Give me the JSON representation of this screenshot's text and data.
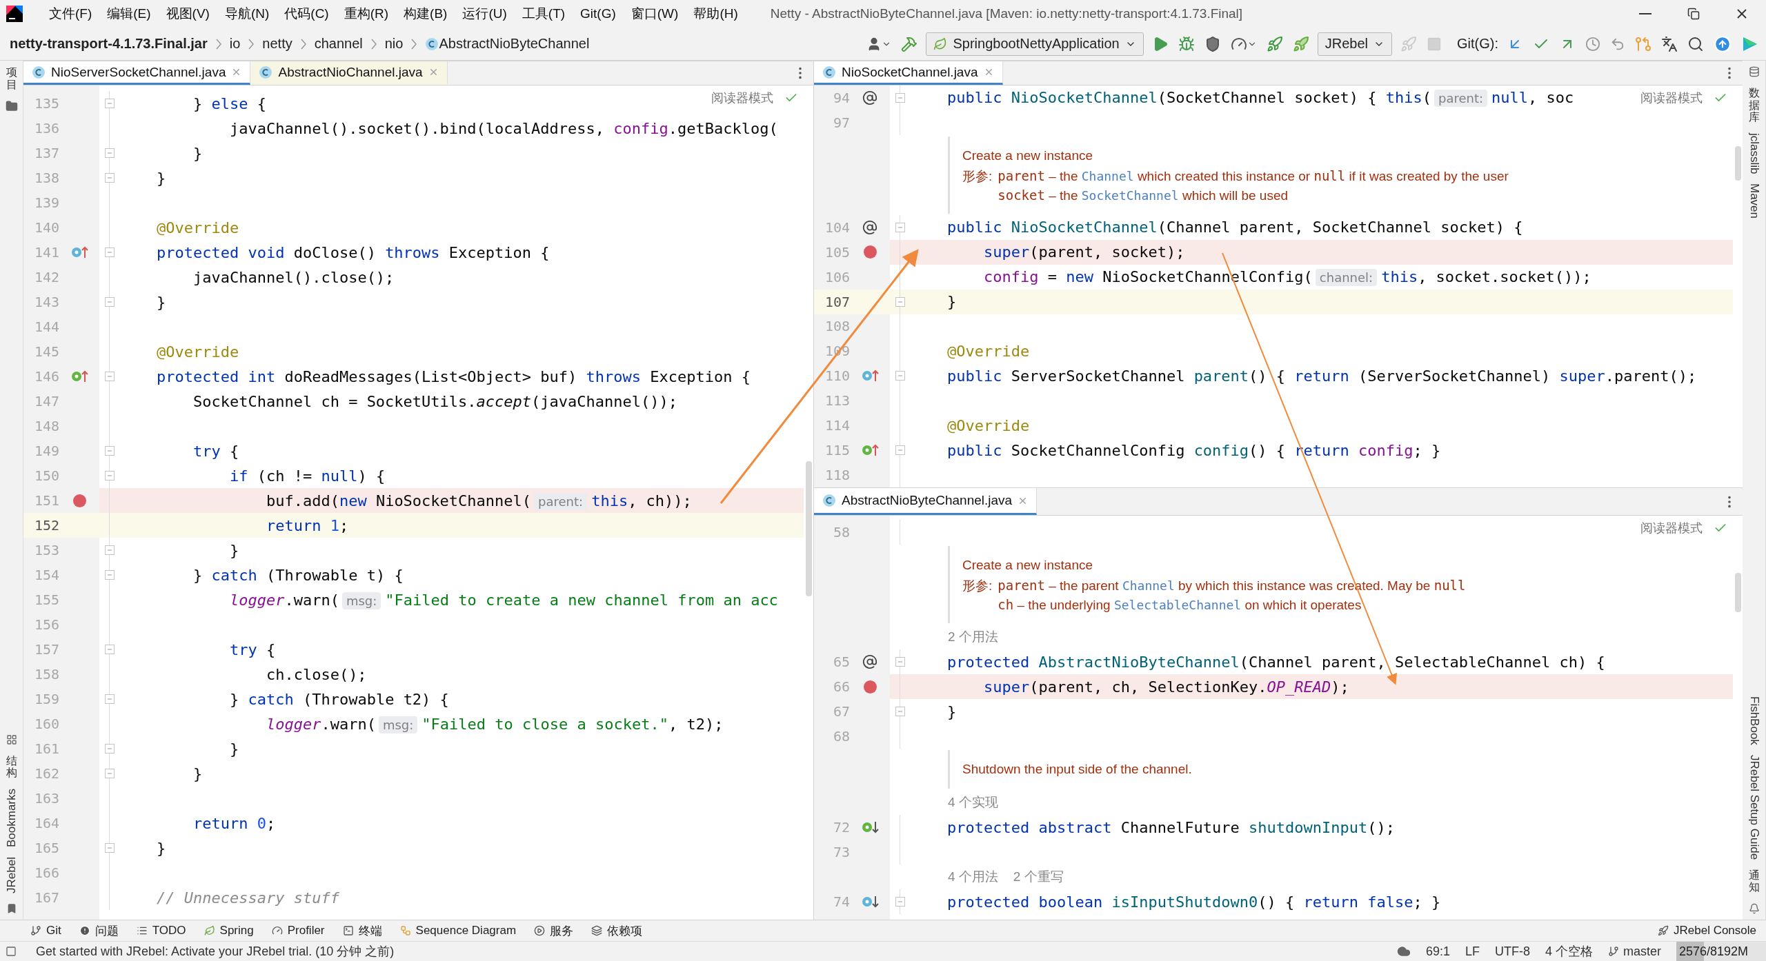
{
  "menu_bar": {
    "items": [
      "文件(F)",
      "编辑(E)",
      "视图(V)",
      "导航(N)",
      "代码(C)",
      "重构(R)",
      "构建(B)",
      "运行(U)",
      "工具(T)",
      "Git(G)",
      "窗口(W)",
      "帮助(H)"
    ],
    "title": "Netty - AbstractNioByteChannel.java [Maven: io.netty:netty-transport:4.1.73.Final]"
  },
  "nav_bar": {
    "breadcrumbs": [
      {
        "label": "netty-transport-4.1.73.Final.jar",
        "kind": "jar"
      },
      {
        "label": "io",
        "kind": "package"
      },
      {
        "label": "netty",
        "kind": "package"
      },
      {
        "label": "channel",
        "kind": "package"
      },
      {
        "label": "nio",
        "kind": "package"
      },
      {
        "label": "AbstractNioByteChannel",
        "kind": "class"
      }
    ]
  },
  "toolbar": {
    "items": [
      {
        "kind": "user",
        "disabled": false
      },
      {
        "kind": "build",
        "disabled": false
      },
      {
        "kind": "run_config",
        "label": "SpringbootNettyApplication",
        "disabled": false
      },
      {
        "kind": "run",
        "disabled": false
      },
      {
        "kind": "debug",
        "disabled": false
      },
      {
        "kind": "coverage",
        "disabled": false
      },
      {
        "kind": "profile",
        "disabled": false
      },
      {
        "kind": "jrebel_run",
        "disabled": false
      },
      {
        "kind": "jrebel_debug",
        "disabled": false
      },
      {
        "kind": "dropdown",
        "label": "JRebel",
        "disabled": false
      },
      {
        "kind": "rocket",
        "disabled": true
      },
      {
        "kind": "stop",
        "disabled": true
      },
      {
        "kind": "label",
        "label": "Git(G):"
      },
      {
        "kind": "update",
        "disabled": false
      },
      {
        "kind": "commit",
        "disabled": false
      },
      {
        "kind": "push",
        "disabled": false
      },
      {
        "kind": "history",
        "disabled": false
      },
      {
        "kind": "rollback",
        "disabled": false
      },
      {
        "kind": "vcs",
        "disabled": false
      },
      {
        "kind": "translate",
        "disabled": false
      },
      {
        "kind": "search",
        "disabled": false
      },
      {
        "kind": "upgrade",
        "disabled": false
      },
      {
        "kind": "toolbox",
        "disabled": false
      }
    ]
  },
  "left_stripe": {
    "top": [
      {
        "label": "项目",
        "kind": "cjk"
      }
    ],
    "bottom": [
      {
        "label": "结构",
        "kind": "cjk"
      },
      {
        "label": "Bookmarks",
        "kind": "latin"
      },
      {
        "label": "JRebel",
        "kind": "latin"
      }
    ]
  },
  "left_editor": {
    "reader_mode": "阅读器模式",
    "tabs": [
      {
        "label": "NioServerSocketChannel.java",
        "selected": true
      },
      {
        "label": "AbstractNioChannel.java",
        "selected": false
      }
    ],
    "lines": [
      {
        "kind": "code",
        "num": "135",
        "fold": true,
        "breakpoint": false,
        "current": false,
        "code": [
          {
            "kind": "plain",
            "text": "        } "
          },
          {
            "kind": "keyword",
            "text": "else"
          },
          {
            "kind": "plain",
            "text": " {"
          }
        ]
      },
      {
        "kind": "code",
        "num": "136",
        "fold": false,
        "breakpoint": false,
        "current": false,
        "code": [
          {
            "kind": "plain",
            "text": "            javaChannel().socket().bind(localAddress, "
          },
          {
            "kind": "field",
            "text": "config"
          },
          {
            "kind": "plain",
            "text": ".getBacklog("
          }
        ]
      },
      {
        "kind": "code",
        "num": "137",
        "fold": true,
        "breakpoint": false,
        "current": false,
        "code": [
          {
            "kind": "plain",
            "text": "        }"
          }
        ]
      },
      {
        "kind": "code",
        "num": "138",
        "fold": true,
        "breakpoint": false,
        "current": false,
        "code": [
          {
            "kind": "plain",
            "text": "    }"
          }
        ]
      },
      {
        "kind": "code",
        "num": "139",
        "fold": false,
        "breakpoint": false,
        "current": false
      },
      {
        "kind": "code",
        "num": "140",
        "fold": false,
        "breakpoint": false,
        "current": false,
        "code": [
          {
            "kind": "annotation",
            "text": "    @Override"
          }
        ]
      },
      {
        "kind": "code",
        "num": "141",
        "fold": true,
        "breakpoint": false,
        "current": false,
        "marker": {
          "kind": "override_up"
        },
        "code": [
          {
            "kind": "keyword",
            "text": "    protected void"
          },
          {
            "kind": "plain",
            "text": " doClose() "
          },
          {
            "kind": "keyword",
            "text": "throws"
          },
          {
            "kind": "plain",
            "text": " Exception {"
          }
        ]
      },
      {
        "kind": "code",
        "num": "142",
        "fold": false,
        "breakpoint": false,
        "current": false,
        "code": [
          {
            "kind": "plain",
            "text": "        javaChannel().close();"
          }
        ]
      },
      {
        "kind": "code",
        "num": "143",
        "fold": true,
        "breakpoint": false,
        "current": false,
        "code": [
          {
            "kind": "plain",
            "text": "    }"
          }
        ]
      },
      {
        "kind": "code",
        "num": "144",
        "fold": false,
        "breakpoint": false,
        "current": false
      },
      {
        "kind": "code",
        "num": "145",
        "fold": false,
        "breakpoint": false,
        "current": false,
        "code": [
          {
            "kind": "annotation",
            "text": "    @Override"
          }
        ]
      },
      {
        "kind": "code",
        "num": "146",
        "fold": true,
        "breakpoint": false,
        "current": false,
        "marker": {
          "kind": "implements_up"
        },
        "code": [
          {
            "kind": "keyword",
            "text": "    protected int"
          },
          {
            "kind": "plain",
            "text": " doReadMessages(List<Object> buf) "
          },
          {
            "kind": "keyword",
            "text": "throws"
          },
          {
            "kind": "plain",
            "text": " Exception {"
          }
        ]
      },
      {
        "kind": "code",
        "num": "147",
        "fold": false,
        "breakpoint": false,
        "current": false,
        "code": [
          {
            "kind": "plain",
            "text": "        SocketChannel ch = SocketUtils."
          },
          {
            "kind": "italic",
            "text": "accept"
          },
          {
            "kind": "plain",
            "text": "(javaChannel());"
          }
        ]
      },
      {
        "kind": "code",
        "num": "148",
        "fold": false,
        "breakpoint": false,
        "current": false
      },
      {
        "kind": "code",
        "num": "149",
        "fold": true,
        "breakpoint": false,
        "current": false,
        "code": [
          {
            "kind": "keyword",
            "text": "        try"
          },
          {
            "kind": "plain",
            "text": " {"
          }
        ]
      },
      {
        "kind": "code",
        "num": "150",
        "fold": true,
        "breakpoint": false,
        "current": false,
        "code": [
          {
            "kind": "keyword",
            "text": "            if"
          },
          {
            "kind": "plain",
            "text": " (ch != "
          },
          {
            "kind": "keyword",
            "text": "null"
          },
          {
            "kind": "plain",
            "text": ") {"
          }
        ]
      },
      {
        "kind": "code",
        "num": "151",
        "fold": false,
        "breakpoint": true,
        "current": false,
        "code": [
          {
            "kind": "plain",
            "text": "                buf.add("
          },
          {
            "kind": "keyword",
            "text": "new"
          },
          {
            "kind": "plain",
            "text": " NioSocketChannel("
          },
          {
            "kind": "hint",
            "text": "parent:"
          },
          {
            "kind": "keyword",
            "text": "this"
          },
          {
            "kind": "plain",
            "text": ", ch));"
          }
        ]
      },
      {
        "kind": "code",
        "num": "152",
        "fold": false,
        "breakpoint": false,
        "current": true,
        "code": [
          {
            "kind": "keyword",
            "text": "                return "
          },
          {
            "kind": "number",
            "text": "1"
          },
          {
            "kind": "plain",
            "text": ";"
          }
        ]
      },
      {
        "kind": "code",
        "num": "153",
        "fold": true,
        "breakpoint": false,
        "current": false,
        "code": [
          {
            "kind": "plain",
            "text": "            }"
          }
        ]
      },
      {
        "kind": "code",
        "num": "154",
        "fold": true,
        "breakpoint": false,
        "current": false,
        "code": [
          {
            "kind": "plain",
            "text": "        } "
          },
          {
            "kind": "keyword",
            "text": "catch"
          },
          {
            "kind": "plain",
            "text": " (Throwable t) {"
          }
        ]
      },
      {
        "kind": "code",
        "num": "155",
        "fold": false,
        "breakpoint": false,
        "current": false,
        "code": [
          {
            "kind": "static",
            "text": "            logger"
          },
          {
            "kind": "plain",
            "text": ".warn("
          },
          {
            "kind": "hint",
            "text": "msg:"
          },
          {
            "kind": "string",
            "text": "\"Failed to create a new channel from an acc"
          }
        ]
      },
      {
        "kind": "code",
        "num": "156",
        "fold": false,
        "breakpoint": false,
        "current": false
      },
      {
        "kind": "code",
        "num": "157",
        "fold": true,
        "breakpoint": false,
        "current": false,
        "code": [
          {
            "kind": "keyword",
            "text": "            try"
          },
          {
            "kind": "plain",
            "text": " {"
          }
        ]
      },
      {
        "kind": "code",
        "num": "158",
        "fold": false,
        "breakpoint": false,
        "current": false,
        "code": [
          {
            "kind": "plain",
            "text": "                ch.close();"
          }
        ]
      },
      {
        "kind": "code",
        "num": "159",
        "fold": true,
        "breakpoint": false,
        "current": false,
        "code": [
          {
            "kind": "plain",
            "text": "            } "
          },
          {
            "kind": "keyword",
            "text": "catch"
          },
          {
            "kind": "plain",
            "text": " (Throwable t2) {"
          }
        ]
      },
      {
        "kind": "code",
        "num": "160",
        "fold": false,
        "breakpoint": false,
        "current": false,
        "code": [
          {
            "kind": "static",
            "text": "                logger"
          },
          {
            "kind": "plain",
            "text": ".warn("
          },
          {
            "kind": "hint",
            "text": "msg:"
          },
          {
            "kind": "string",
            "text": "\"Failed to close a socket.\""
          },
          {
            "kind": "plain",
            "text": ", t2);"
          }
        ]
      },
      {
        "kind": "code",
        "num": "161",
        "fold": true,
        "breakpoint": false,
        "current": false,
        "code": [
          {
            "kind": "plain",
            "text": "            }"
          }
        ]
      },
      {
        "kind": "code",
        "num": "162",
        "fold": true,
        "breakpoint": false,
        "current": false,
        "code": [
          {
            "kind": "plain",
            "text": "        }"
          }
        ]
      },
      {
        "kind": "code",
        "num": "163",
        "fold": false,
        "breakpoint": false,
        "current": false
      },
      {
        "kind": "code",
        "num": "164",
        "fold": false,
        "breakpoint": false,
        "current": false,
        "code": [
          {
            "kind": "keyword",
            "text": "        return "
          },
          {
            "kind": "number",
            "text": "0"
          },
          {
            "kind": "plain",
            "text": ";"
          }
        ]
      },
      {
        "kind": "code",
        "num": "165",
        "fold": true,
        "breakpoint": false,
        "current": false,
        "code": [
          {
            "kind": "plain",
            "text": "    }"
          }
        ]
      },
      {
        "kind": "code",
        "num": "166",
        "fold": false,
        "breakpoint": false,
        "current": false
      },
      {
        "kind": "code",
        "num": "167",
        "fold": false,
        "breakpoint": false,
        "current": false,
        "code": [
          {
            "kind": "comment",
            "text": "    // Unnecessary stuff"
          }
        ]
      }
    ]
  },
  "right_top_editor": {
    "reader_mode": "阅读器模式",
    "tabs": [
      {
        "label": "NioSocketChannel.java",
        "selected": true
      }
    ],
    "lines": [
      {
        "kind": "code",
        "num": "94",
        "fold": true,
        "breakpoint": false,
        "current": false,
        "marker": {
          "kind": "at"
        },
        "code": [
          {
            "kind": "keyword",
            "text": "    public"
          },
          {
            "kind": "method",
            "text": " NioSocketChannel"
          },
          {
            "kind": "plain",
            "text": "(SocketChannel socket) { "
          },
          {
            "kind": "keyword",
            "text": "this"
          },
          {
            "kind": "plain",
            "text": "("
          },
          {
            "kind": "hint",
            "text": "parent:"
          },
          {
            "kind": "keyword",
            "text": "null"
          },
          {
            "kind": "plain",
            "text": ", soc"
          }
        ]
      },
      {
        "kind": "code",
        "num": "97",
        "fold": false,
        "breakpoint": false,
        "current": false
      },
      {
        "kind": "doc",
        "title": "Create a new instance",
        "params": [
          {
            "label": "形参:",
            "parts": [
              {
                "kind": "param",
                "text": "parent"
              },
              {
                "kind": "plain",
                "text": " – the "
              },
              {
                "kind": "link",
                "text": "Channel"
              },
              {
                "kind": "plain",
                "text": " which created this instance or "
              },
              {
                "kind": "param",
                "text": "null"
              },
              {
                "kind": "plain",
                "text": " if it was created by the user"
              }
            ]
          },
          {
            "parts": [
              {
                "kind": "param",
                "text": "socket"
              },
              {
                "kind": "plain",
                "text": " – the "
              },
              {
                "kind": "link",
                "text": "SocketChannel"
              },
              {
                "kind": "plain",
                "text": " which will be used"
              }
            ]
          }
        ]
      },
      {
        "kind": "code",
        "num": "104",
        "fold": true,
        "breakpoint": false,
        "current": false,
        "marker": {
          "kind": "at"
        },
        "code": [
          {
            "kind": "keyword",
            "text": "    public"
          },
          {
            "kind": "method",
            "text": " NioSocketChannel"
          },
          {
            "kind": "plain",
            "text": "(Channel parent, SocketChannel socket) {"
          }
        ]
      },
      {
        "kind": "code",
        "num": "105",
        "fold": false,
        "breakpoint": true,
        "current": false,
        "code": [
          {
            "kind": "keyword",
            "text": "        super"
          },
          {
            "kind": "plain",
            "text": "(parent, socket);"
          }
        ]
      },
      {
        "kind": "code",
        "num": "106",
        "fold": false,
        "breakpoint": false,
        "current": false,
        "code": [
          {
            "kind": "field",
            "text": "        config"
          },
          {
            "kind": "plain",
            "text": " = "
          },
          {
            "kind": "keyword",
            "text": "new"
          },
          {
            "kind": "plain",
            "text": " NioSocketChannelConfig("
          },
          {
            "kind": "hint",
            "text": "channel:"
          },
          {
            "kind": "keyword",
            "text": "this"
          },
          {
            "kind": "plain",
            "text": ", socket.socket());"
          }
        ]
      },
      {
        "kind": "code",
        "num": "107",
        "fold": true,
        "breakpoint": false,
        "current": true,
        "code": [
          {
            "kind": "plain",
            "text": "    }"
          }
        ]
      },
      {
        "kind": "code",
        "num": "108",
        "fold": false,
        "breakpoint": false,
        "current": false
      },
      {
        "kind": "code",
        "num": "109",
        "fold": false,
        "breakpoint": false,
        "current": false,
        "code": [
          {
            "kind": "annotation",
            "text": "    @Override"
          }
        ]
      },
      {
        "kind": "code",
        "num": "110",
        "fold": true,
        "breakpoint": false,
        "current": false,
        "marker": {
          "kind": "override_up"
        },
        "code": [
          {
            "kind": "keyword",
            "text": "    public"
          },
          {
            "kind": "plain",
            "text": " ServerSocketChannel "
          },
          {
            "kind": "method",
            "text": "parent"
          },
          {
            "kind": "plain",
            "text": "() { "
          },
          {
            "kind": "keyword",
            "text": "return"
          },
          {
            "kind": "plain",
            "text": " (ServerSocketChannel) "
          },
          {
            "kind": "keyword",
            "text": "super"
          },
          {
            "kind": "plain",
            "text": ".parent();"
          }
        ]
      },
      {
        "kind": "code",
        "num": "113",
        "fold": false,
        "breakpoint": false,
        "current": false
      },
      {
        "kind": "code",
        "num": "114",
        "fold": false,
        "breakpoint": false,
        "current": false,
        "code": [
          {
            "kind": "annotation",
            "text": "    @Override"
          }
        ]
      },
      {
        "kind": "code",
        "num": "115",
        "fold": true,
        "breakpoint": false,
        "current": false,
        "marker": {
          "kind": "implements_up"
        },
        "code": [
          {
            "kind": "keyword",
            "text": "    public"
          },
          {
            "kind": "plain",
            "text": " SocketChannelConfig "
          },
          {
            "kind": "method",
            "text": "config"
          },
          {
            "kind": "plain",
            "text": "() { "
          },
          {
            "kind": "keyword",
            "text": "return "
          },
          {
            "kind": "field",
            "text": "config"
          },
          {
            "kind": "plain",
            "text": "; }"
          }
        ]
      },
      {
        "kind": "code",
        "num": "118",
        "fold": false,
        "breakpoint": false,
        "current": false
      }
    ]
  },
  "right_bottom_editor": {
    "reader_mode": "阅读器模式",
    "tabs": [
      {
        "label": "AbstractNioByteChannel.java",
        "selected": true
      }
    ],
    "lines": [
      {
        "kind": "code",
        "num": "58",
        "fold": false,
        "breakpoint": false,
        "current": false
      },
      {
        "kind": "doc",
        "title": "Create a new instance",
        "params": [
          {
            "label": "形参:",
            "parts": [
              {
                "kind": "param",
                "text": "parent"
              },
              {
                "kind": "plain",
                "text": " – the parent "
              },
              {
                "kind": "link",
                "text": "Channel"
              },
              {
                "kind": "plain",
                "text": " by which this instance was created. May be "
              },
              {
                "kind": "param",
                "text": "null"
              }
            ]
          },
          {
            "parts": [
              {
                "kind": "param",
                "text": "ch"
              },
              {
                "kind": "plain",
                "text": " – the underlying "
              },
              {
                "kind": "link",
                "text": "SelectableChannel"
              },
              {
                "kind": "plain",
                "text": " on which it operates"
              }
            ]
          }
        ]
      },
      {
        "kind": "usage",
        "texts": [
          "2 个用法"
        ]
      },
      {
        "kind": "code",
        "num": "65",
        "fold": true,
        "breakpoint": false,
        "current": false,
        "marker": {
          "kind": "at"
        },
        "code": [
          {
            "kind": "keyword",
            "text": "    protected"
          },
          {
            "kind": "method",
            "text": " AbstractNioByteChannel"
          },
          {
            "kind": "plain",
            "text": "(Channel parent, SelectableChannel ch) {"
          }
        ]
      },
      {
        "kind": "code",
        "num": "66",
        "fold": false,
        "breakpoint": true,
        "current": false,
        "code": [
          {
            "kind": "keyword",
            "text": "        super"
          },
          {
            "kind": "plain",
            "text": "(parent, ch, SelectionKey."
          },
          {
            "kind": "static",
            "text": "OP_READ"
          },
          {
            "kind": "plain",
            "text": ");"
          }
        ]
      },
      {
        "kind": "code",
        "num": "67",
        "fold": true,
        "breakpoint": false,
        "current": false,
        "code": [
          {
            "kind": "plain",
            "text": "    }"
          }
        ]
      },
      {
        "kind": "code",
        "num": "68",
        "fold": false,
        "breakpoint": false,
        "current": false
      },
      {
        "kind": "doc",
        "title": "Shutdown the input side of the channel."
      },
      {
        "kind": "usage",
        "texts": [
          "4 个实现"
        ]
      },
      {
        "kind": "code",
        "num": "72",
        "fold": false,
        "breakpoint": false,
        "current": false,
        "marker": {
          "kind": "implemented_down"
        },
        "code": [
          {
            "kind": "keyword",
            "text": "    protected abstract"
          },
          {
            "kind": "plain",
            "text": " ChannelFuture "
          },
          {
            "kind": "method",
            "text": "shutdownInput"
          },
          {
            "kind": "plain",
            "text": "();"
          }
        ]
      },
      {
        "kind": "code",
        "num": "73",
        "fold": false,
        "breakpoint": false,
        "current": false
      },
      {
        "kind": "usage",
        "texts": [
          "4 个用法",
          "2 个重写"
        ]
      },
      {
        "kind": "code",
        "num": "74",
        "fold": true,
        "breakpoint": false,
        "current": false,
        "marker": {
          "kind": "overridden_down"
        },
        "code": [
          {
            "kind": "keyword",
            "text": "    protected boolean"
          },
          {
            "kind": "method",
            "text": " isInputShutdown0"
          },
          {
            "kind": "plain",
            "text": "() { "
          },
          {
            "kind": "keyword",
            "text": "return false"
          },
          {
            "kind": "plain",
            "text": "; }"
          }
        ]
      }
    ]
  },
  "right_stripe": {
    "top": [
      {
        "label": "数据库",
        "kind": "cjk"
      },
      {
        "label": "jclasslib",
        "kind": "latin"
      },
      {
        "label": "Maven",
        "kind": "latin"
      }
    ],
    "bottom": [
      {
        "label": "FishBook",
        "kind": "latin"
      },
      {
        "label": "JRebel Setup Guide",
        "kind": "latin"
      },
      {
        "label": "通知",
        "kind": "cjk"
      }
    ]
  },
  "tool_windows": {
    "left": [
      {
        "label": "Git",
        "kind": "git"
      },
      {
        "label": "问题",
        "kind": "problems"
      },
      {
        "label": "TODO",
        "kind": "todo"
      },
      {
        "label": "Spring",
        "kind": "spring"
      },
      {
        "label": "Profiler",
        "kind": "profiler"
      },
      {
        "label": "终端",
        "kind": "terminal"
      },
      {
        "label": "Sequence Diagram",
        "kind": "sequence"
      },
      {
        "label": "服务",
        "kind": "services"
      },
      {
        "label": "依赖项",
        "kind": "dependencies"
      }
    ],
    "right": [
      {
        "label": "JRebel Console",
        "kind": "jrebel"
      }
    ]
  },
  "status_bar": {
    "message": "Get started with JRebel: Activate your JRebel trial. (10 分钟 之前)",
    "items": [
      {
        "label": "69:1",
        "kind": "position"
      },
      {
        "label": "LF",
        "kind": "text"
      },
      {
        "label": "UTF-8",
        "kind": "text"
      },
      {
        "label": "4 个空格",
        "kind": "text"
      },
      {
        "label": "master",
        "kind": "branch"
      }
    ],
    "memory": {
      "label": "2576/8192M",
      "level": 0.31
    }
  }
}
